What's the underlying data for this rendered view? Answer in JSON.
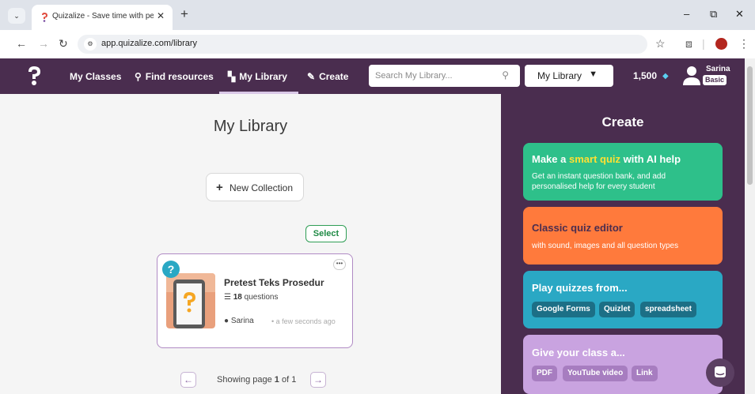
{
  "browser": {
    "tab_title": "Quizalize - Save time with perso",
    "url": "app.quizalize.com/library",
    "tab_menu_icon": "chevron-down-icon",
    "minimize_glyph": "–",
    "restore_glyph": "⧉",
    "close_glyph": "✕"
  },
  "header": {
    "nav": {
      "my_classes": "My Classes",
      "find_resources": "Find resources",
      "my_library": "My Library",
      "create": "Create"
    },
    "search_placeholder": "Search My Library...",
    "library_select": "My Library",
    "points": "1,500",
    "user_name": "Sarina",
    "user_plan": "Basic"
  },
  "main": {
    "page_title": "My Library",
    "new_collection_label": "New Collection",
    "select_label": "Select",
    "quiz_card": {
      "title": "Pretest Teks Prosedur",
      "question_count": "18",
      "questions_label": "questions",
      "owner": "Sarina",
      "time": "a few seconds ago"
    },
    "pagination": {
      "prefix": "Showing page ",
      "current": "1",
      "middle": " of ",
      "total": "1"
    }
  },
  "create_panel": {
    "title": "Create",
    "smart_quiz": {
      "title_pre": "Make a ",
      "title_highlight": "smart quiz",
      "title_post": " with AI help",
      "description": "Get an instant question bank, and add personalised help for every student"
    },
    "classic_editor": {
      "title": "Classic quiz editor",
      "description": "with sound, images and all question types"
    },
    "play_quizzes": {
      "title": "Play quizzes from...",
      "chips": [
        "Google Forms",
        "Quizlet",
        "spreadsheet"
      ]
    },
    "give_class": {
      "title": "Give your class a...",
      "chips": [
        "PDF",
        "YouTube video",
        "Link"
      ]
    }
  },
  "colors": {
    "header_bg": "#4a2d4f",
    "smart_quiz_bg": "#2ec08a",
    "smart_quiz_highlight": "#ffe033",
    "classic_bg": "#ff7a3c",
    "classic_text": "#4a2d4f",
    "play_bg": "#2aa8c4",
    "play_chip": "#1c6f86",
    "give_bg": "#c9a3e0",
    "give_chip": "#a77dc0",
    "select_green": "#2f9e55"
  }
}
